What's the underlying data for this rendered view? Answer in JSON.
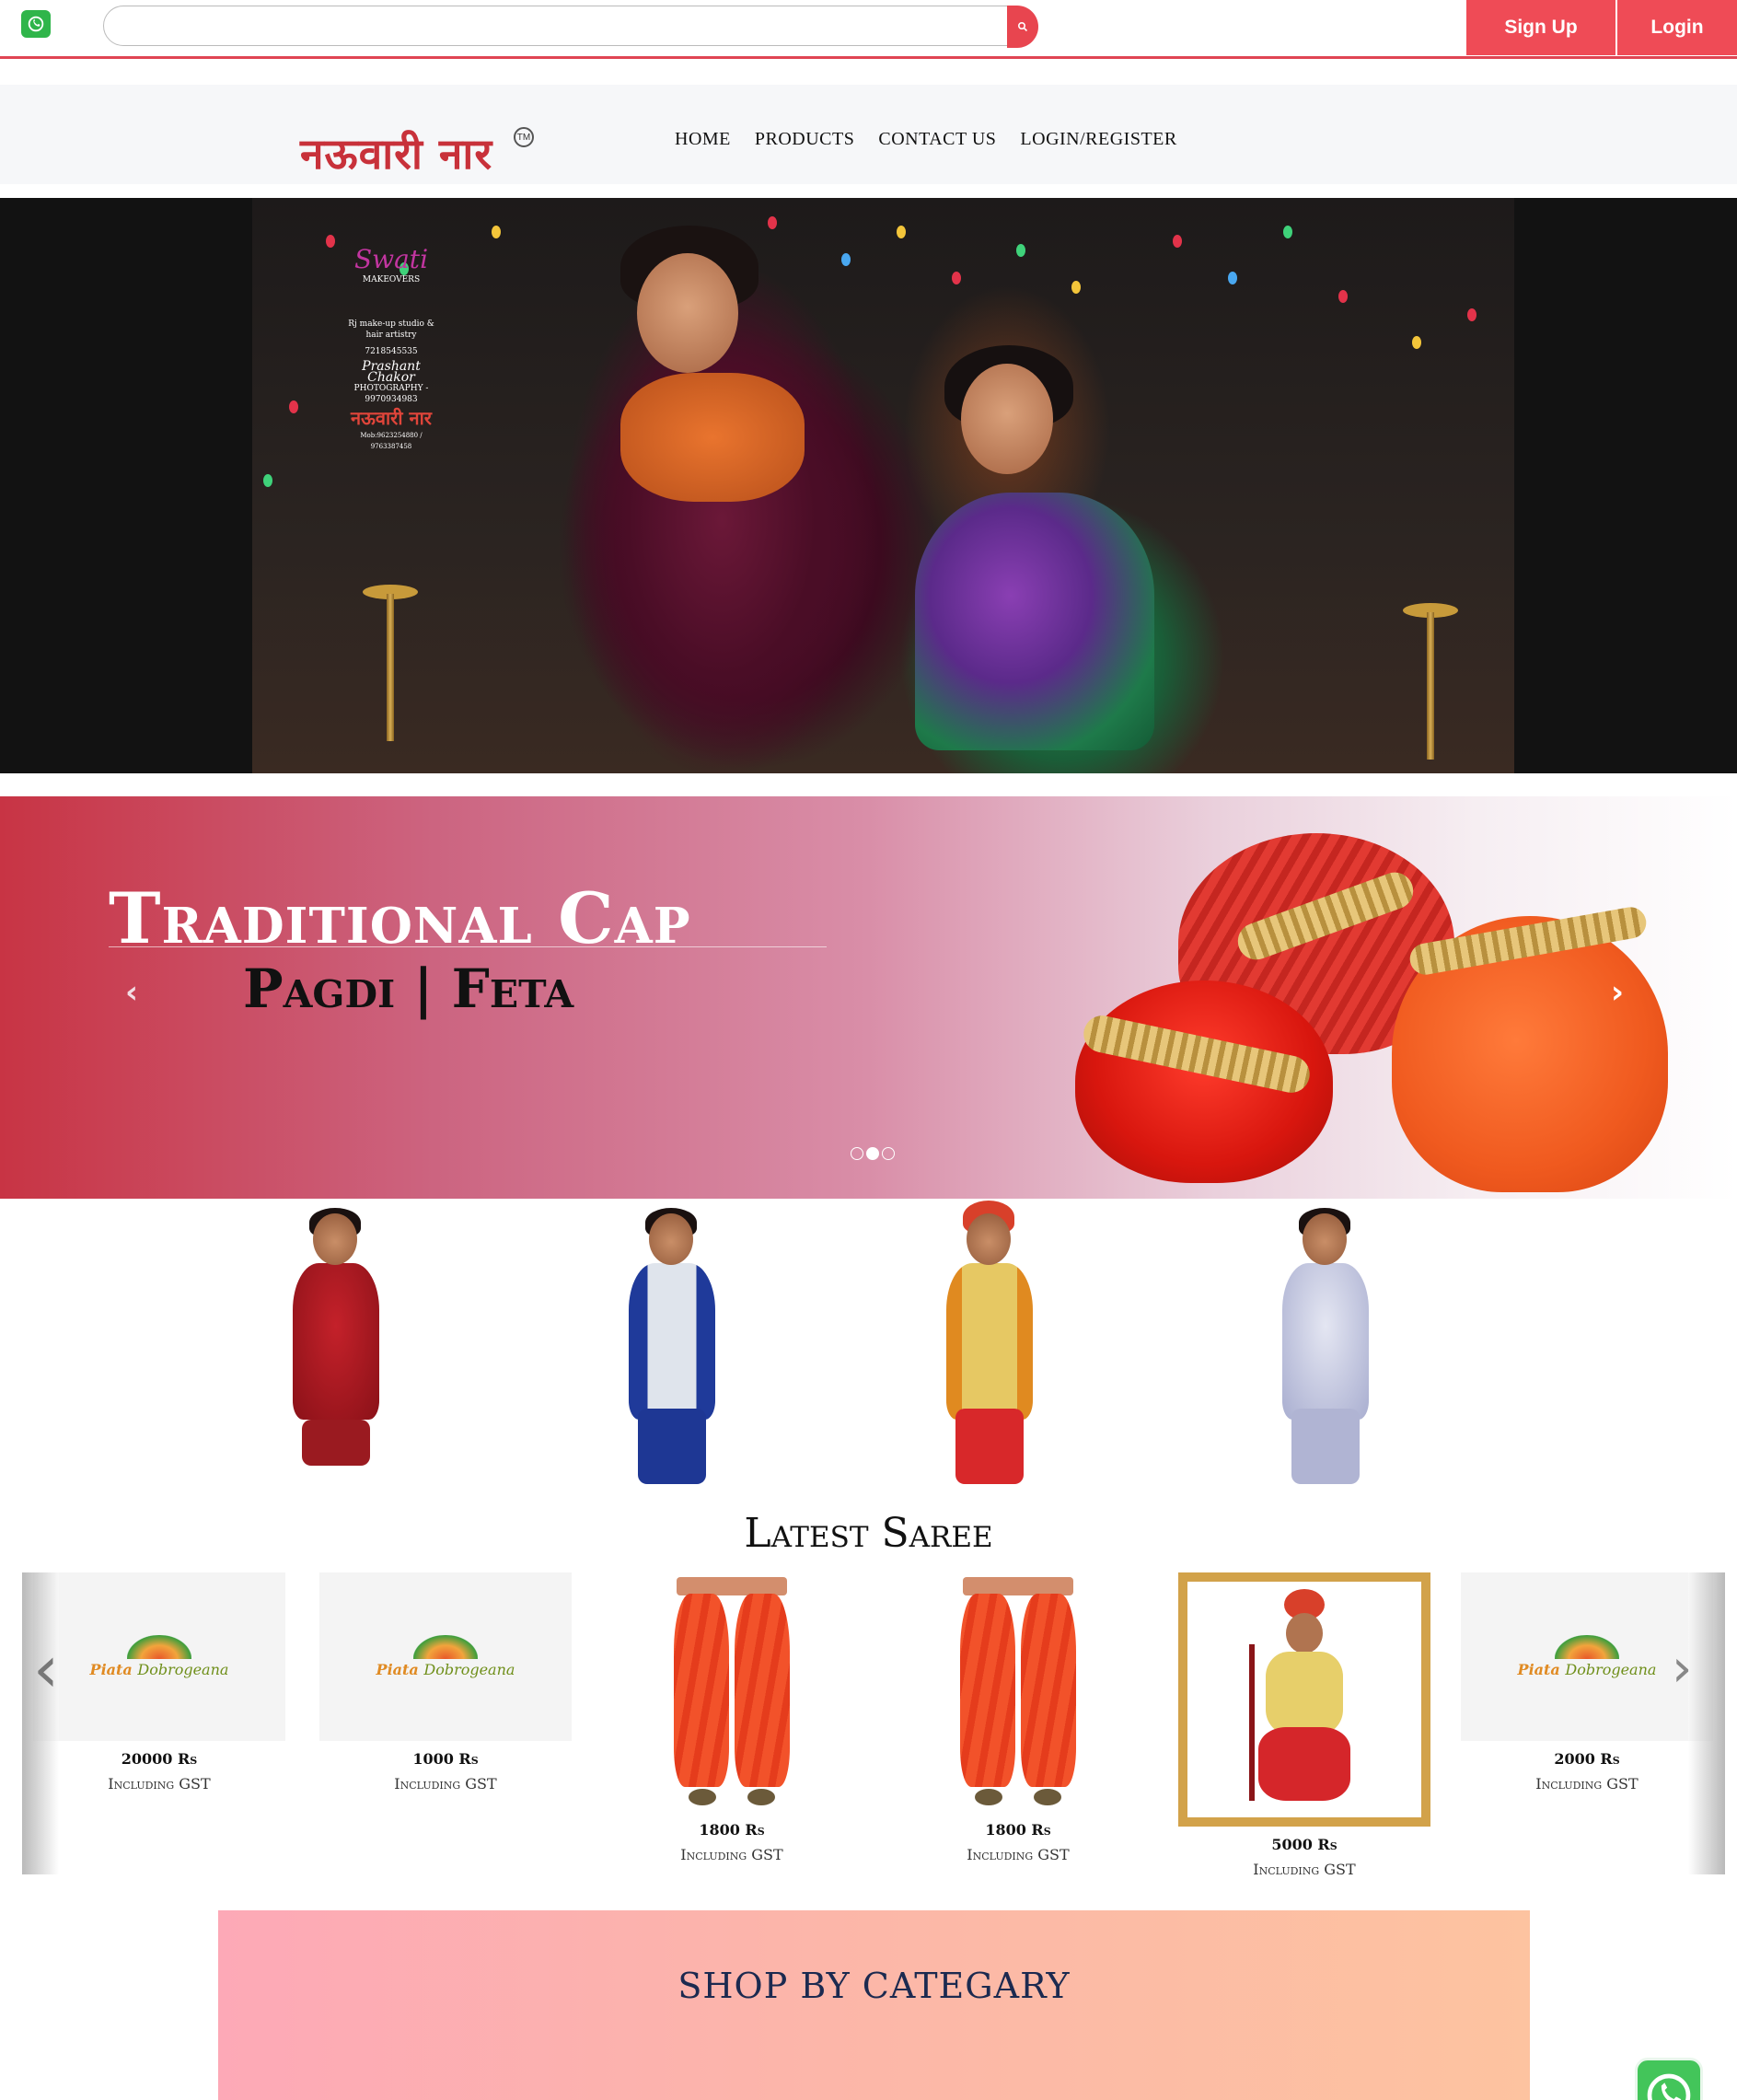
{
  "topbar": {
    "search_placeholder": "",
    "signup_label": "Sign Up",
    "login_label": "Login",
    "accent_color": "#ef4b56",
    "icons": {
      "whatsapp": "whatsapp-icon",
      "search": "search-icon"
    }
  },
  "header": {
    "logo_text": "नऊवारी नार",
    "logo_mark": "TM",
    "nav": [
      {
        "label": "HOME"
      },
      {
        "label": "PRODUCTS"
      },
      {
        "label": "CONTACT US"
      },
      {
        "label": "LOGIN/REGISTER"
      }
    ]
  },
  "hero": {
    "watermark": {
      "brand": "Swati",
      "line1": "MAKEOVERS",
      "line2": "Rj make-up studio & hair artistry",
      "line3": "7218545535",
      "line4": "Prashant Chakor",
      "line5": "PHOTOGRAPHY - 9970934983",
      "line6": "नऊवारी नार",
      "line7": "Mob:9623254880 / 9763387458"
    }
  },
  "banner": {
    "title": "Traditional Cap",
    "subtitle": "Pagdi | Feta",
    "prev_icon": "chevron-left-icon",
    "next_icon": "chevron-right-icon",
    "slide_count": 3,
    "active_slide": 2
  },
  "latest": {
    "title": "Latest Saree",
    "products": [
      {
        "price": "20000 Rs",
        "gst": "Including GST",
        "image": "placeholder-logo"
      },
      {
        "price": "1000 Rs",
        "gst": "Including GST",
        "image": "placeholder-logo"
      },
      {
        "price": "1800 Rs",
        "gst": "Including GST",
        "image": "dhoti"
      },
      {
        "price": "1800 Rs",
        "gst": "Including GST",
        "image": "dhoti"
      },
      {
        "price": "5000 Rs",
        "gst": "Including GST",
        "image": "groom"
      },
      {
        "price": "2000 Rs",
        "gst": "Including GST",
        "image": "placeholder-logo"
      }
    ],
    "placeholder_logo": {
      "part1": "Piata ",
      "part2": "Dobrogeana"
    }
  },
  "shop": {
    "title": "SHOP BY CATEGARY"
  }
}
